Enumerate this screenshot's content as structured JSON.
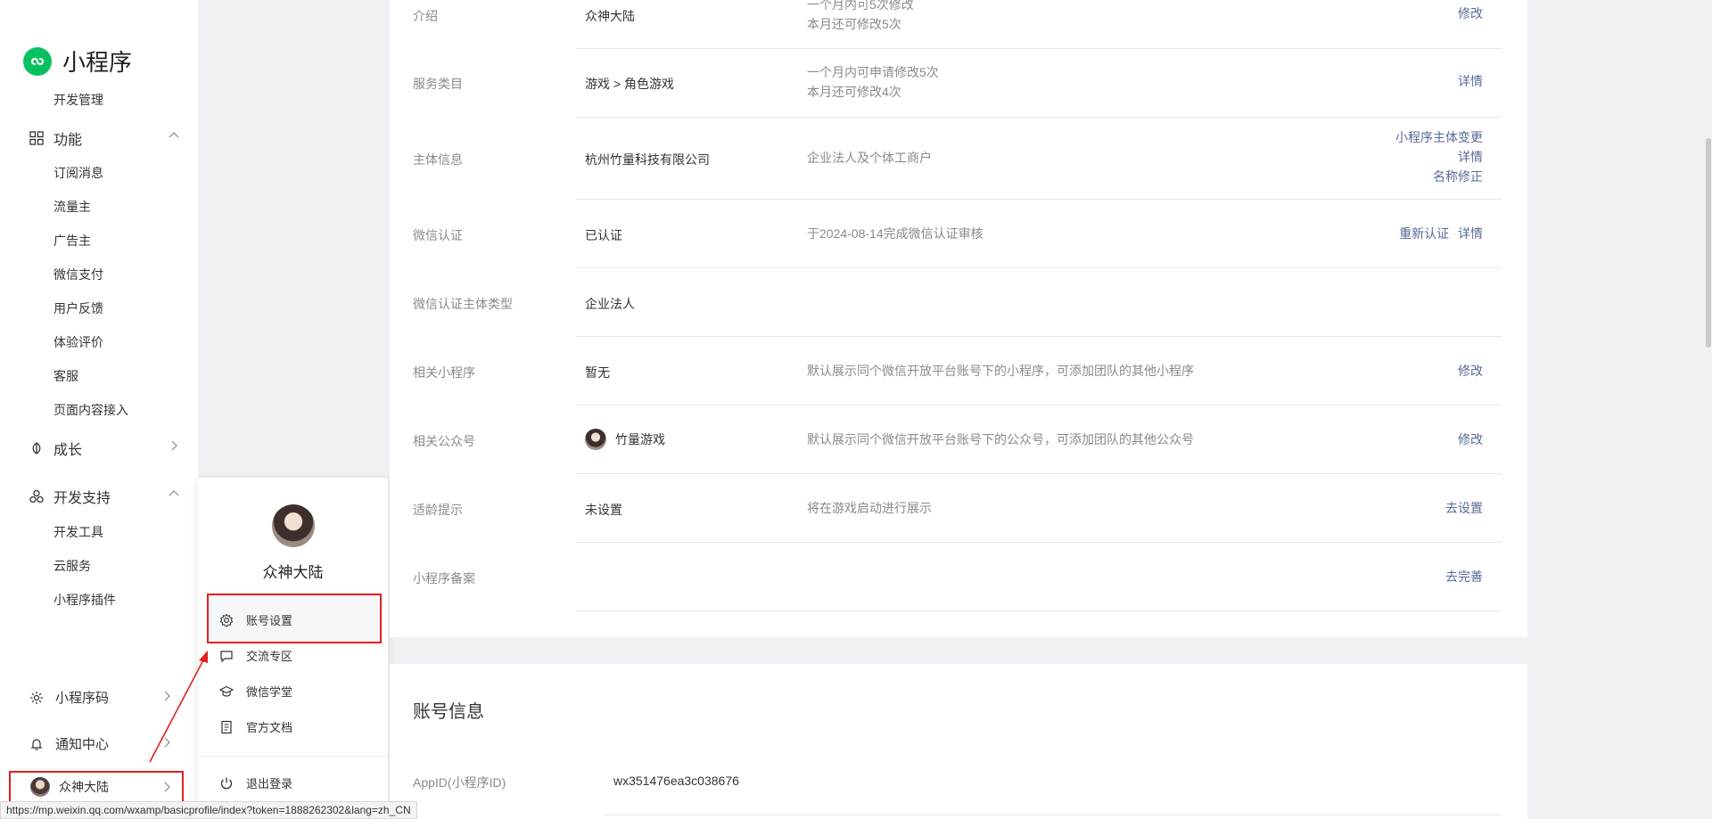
{
  "sidebar": {
    "brand": "小程序",
    "dev_manage": "开发管理",
    "function_group": "功能",
    "function_items": [
      "订阅消息",
      "流量主",
      "广告主",
      "微信支付",
      "用户反馈",
      "体验评价",
      "客服",
      "页面内容接入"
    ],
    "growth_group": "成长",
    "devsupport_group": "开发支持",
    "devsupport_items": [
      "开发工具",
      "云服务",
      "小程序插件"
    ],
    "qrcode": "小程序码",
    "notify": "通知中心",
    "user": "众神大陆"
  },
  "popup": {
    "name": "众神大陆",
    "items": [
      "账号设置",
      "交流专区",
      "微信学堂",
      "官方文档"
    ],
    "logout": "退出登录"
  },
  "basic_info": {
    "intro": {
      "label": "介绍",
      "value": "众神大陆",
      "tip1": "一个月内可5次修改",
      "tip2": "本月还可修改5次",
      "action": "修改"
    },
    "service": {
      "label": "服务类目",
      "value": "游戏 > 角色游戏",
      "tip1": "一个月内可申请修改5次",
      "tip2": "本月还可修改4次",
      "action": "详情"
    },
    "subject": {
      "label": "主体信息",
      "value": "杭州竹量科技有限公司",
      "tip": "企业法人及个体工商户",
      "action1": "小程序主体变更",
      "action2": "详情",
      "action3": "名称修正"
    },
    "wx_verify": {
      "label": "微信认证",
      "value": "已认证",
      "tip": "于2024-08-14完成微信认证审核",
      "action1": "重新认证",
      "action2": "详情"
    },
    "verify_type": {
      "label": "微信认证主体类型",
      "value": "企业法人"
    },
    "related_mp": {
      "label": "相关小程序",
      "value": "暂无",
      "tip": "默认展示同个微信开放平台账号下的小程序，可添加团队的其他小程序",
      "action": "修改"
    },
    "related_oa": {
      "label": "相关公众号",
      "value": "竹量游戏",
      "tip": "默认展示同个微信开放平台账号下的公众号，可添加团队的其他公众号",
      "action": "修改"
    },
    "age_hint": {
      "label": "适龄提示",
      "value": "未设置",
      "tip": "将在游戏启动进行展示",
      "action": "去设置"
    },
    "filing": {
      "label": "小程序备案",
      "action": "去完善"
    }
  },
  "account_info": {
    "title": "账号信息",
    "appid_label": "AppID(小程序ID)",
    "appid_value": "wx351476ea3c038676"
  },
  "status_url": "https://mp.weixin.qq.com/wxamp/basicprofile/index?token=1888262302&lang=zh_CN",
  "colors": {
    "link": "#576b95",
    "brand": "#07c160",
    "annotation": "#e02020"
  }
}
